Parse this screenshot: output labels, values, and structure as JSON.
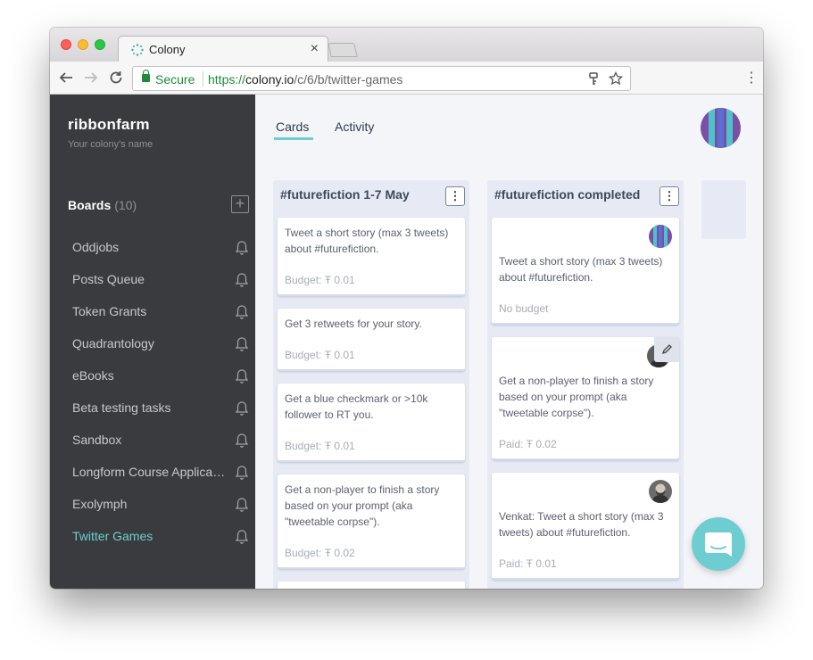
{
  "browser": {
    "tab_title": "Colony",
    "tab_close": "×",
    "security_label": "Secure",
    "url_scheme": "https://",
    "url_host": "colony.io",
    "url_path": "/c/6/b/twitter-games",
    "menu_glyph": "⋮"
  },
  "sidebar": {
    "colony_name": "ribbonfarm",
    "colony_subtitle": "Your colony's name",
    "boards_label": "Boards",
    "boards_count": "(10)",
    "boards": [
      {
        "label": "Oddjobs",
        "active": false
      },
      {
        "label": "Posts Queue",
        "active": false
      },
      {
        "label": "Token Grants",
        "active": false
      },
      {
        "label": "Quadrantology",
        "active": false
      },
      {
        "label": "eBooks",
        "active": false
      },
      {
        "label": "Beta testing tasks",
        "active": false
      },
      {
        "label": "Sandbox",
        "active": false
      },
      {
        "label": "Longform Course Applications",
        "active": false
      },
      {
        "label": "Exolymph",
        "active": false
      },
      {
        "label": "Twitter Games",
        "active": true
      }
    ]
  },
  "main": {
    "tabs": [
      {
        "label": "Cards",
        "active": true
      },
      {
        "label": "Activity",
        "active": false
      }
    ],
    "columns": [
      {
        "title": "#futurefiction 1-7 May",
        "menu_glyph": "⋮",
        "cards": [
          {
            "text": "Tweet a short story (max 3 tweets) about #futurefiction.",
            "footer": "Budget: Ŧ 0.01"
          },
          {
            "text": "Get 3 retweets for your story.",
            "footer": "Budget: Ŧ 0.01"
          },
          {
            "text": "Get a blue checkmark or >10k follower to RT you.",
            "footer": "Budget: Ŧ 0.01"
          },
          {
            "text": "Get a non-player to finish a story based on your prompt (aka \"tweetable corpse\").",
            "footer": "Budget: Ŧ 0.02"
          }
        ]
      },
      {
        "title": "#futurefiction completed",
        "menu_glyph": "⋮",
        "cards": [
          {
            "text": "Tweet a short story (max 3 tweets) about #futurefiction.",
            "footer": "No budget",
            "avatar": "striped-avatar"
          },
          {
            "text": "Get a non-player to finish a story based on your prompt (aka \"tweetable corpse\").",
            "footer": "Paid: Ŧ 0.02",
            "avatar": "photo-avatar",
            "edit_icon": "pencil-icon"
          },
          {
            "text": "Venkat: Tweet a short story (max 3 tweets) about #futurefiction.",
            "footer": "Paid: Ŧ 0.01",
            "avatar": "photo-avatar"
          }
        ]
      }
    ]
  },
  "colors": {
    "accent": "#6ecdd0",
    "sidebar_bg": "#393b3e",
    "avatar_purple": "#7b4fa8",
    "avatar_teal": "#4ec3c7"
  }
}
